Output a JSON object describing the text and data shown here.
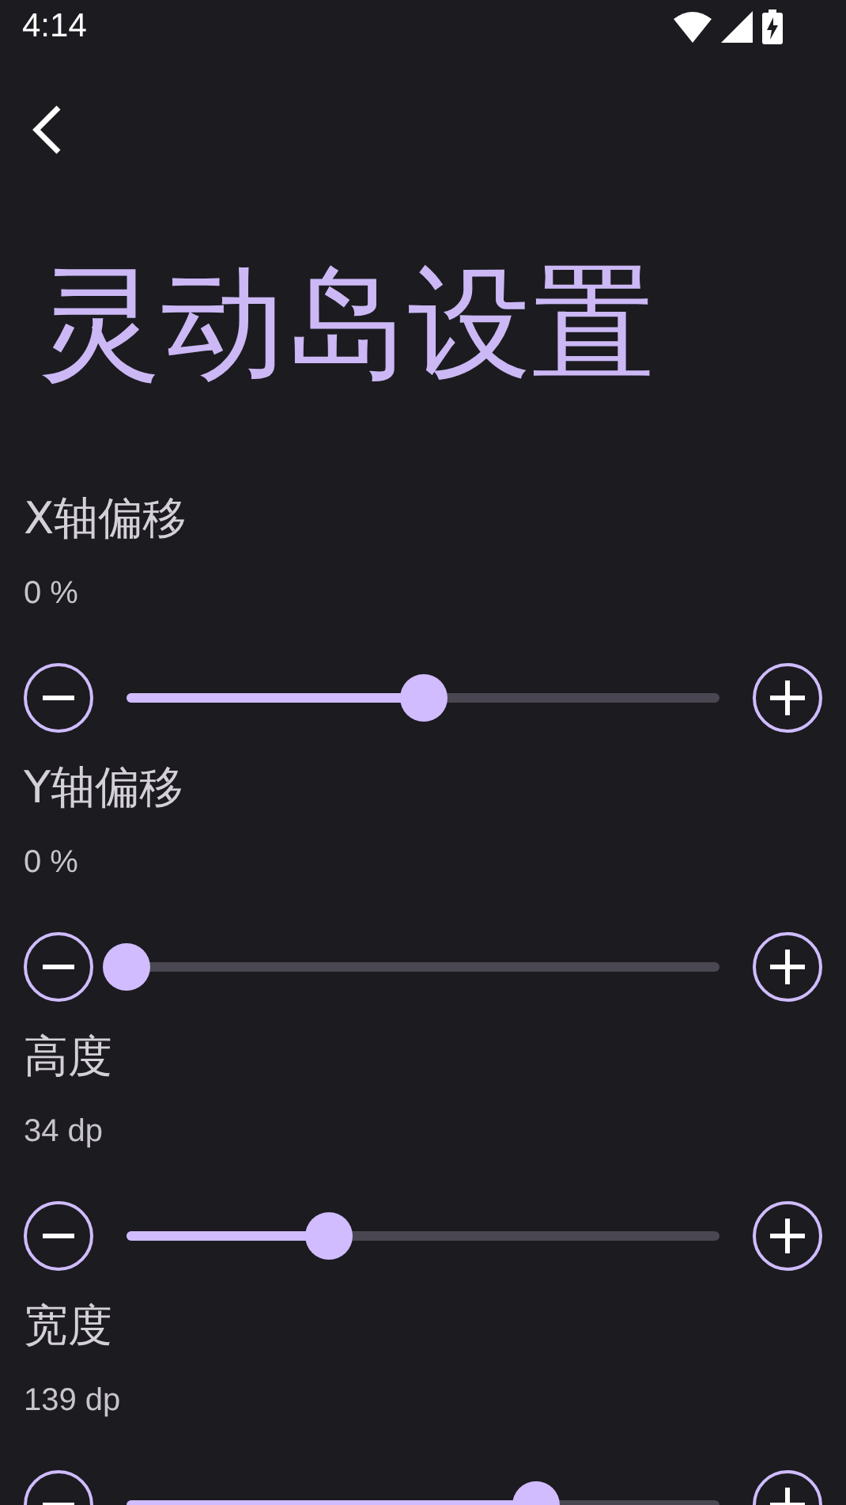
{
  "status_bar": {
    "time": "4:14"
  },
  "title": "灵动岛设置",
  "settings": [
    {
      "label": "X轴偏移",
      "value": "0 %",
      "level": 0.5
    },
    {
      "label": "Y轴偏移",
      "value": "0 %",
      "level": 0
    },
    {
      "label": "高度",
      "value": "34 dp",
      "level": 0.34
    },
    {
      "label": "宽度",
      "value": "139 dp",
      "level": 0.69
    }
  ]
}
